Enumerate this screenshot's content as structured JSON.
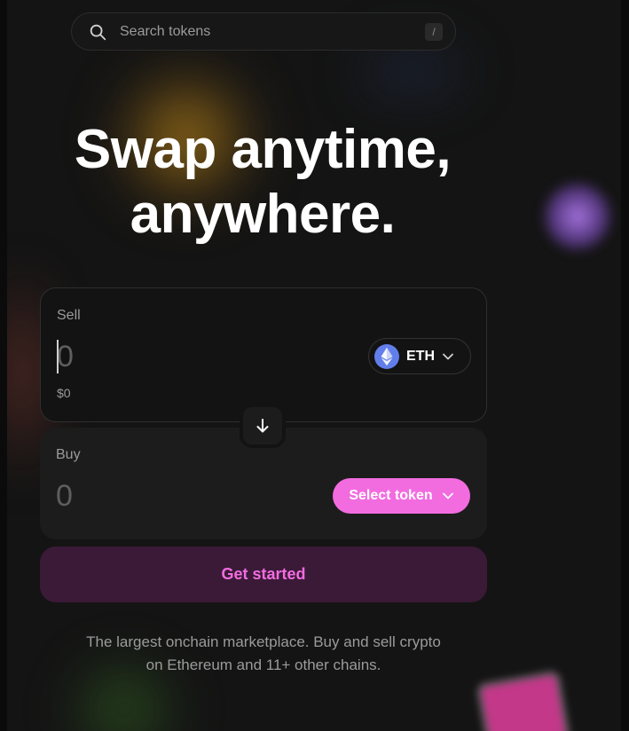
{
  "search": {
    "placeholder": "Search tokens",
    "shortcut_key": "/"
  },
  "hero": {
    "line1": "Swap anytime,",
    "line2": "anywhere."
  },
  "sell": {
    "label": "Sell",
    "amount": "0",
    "usd_value": "$0",
    "token_symbol": "ETH",
    "token_icon": "ethereum-icon"
  },
  "buy": {
    "label": "Buy",
    "amount": "0",
    "select_label": "Select token"
  },
  "swap_direction_icon": "arrow-down-icon",
  "cta": {
    "label": "Get started"
  },
  "tagline": {
    "line1": "The largest onchain marketplace. Buy and sell crypto",
    "line2": "on Ethereum and 11+ other chains."
  },
  "colors": {
    "accent_pink": "#f26ce0",
    "cta_bg": "#3b1a38",
    "eth_blue": "#627eea",
    "background": "#131313"
  }
}
